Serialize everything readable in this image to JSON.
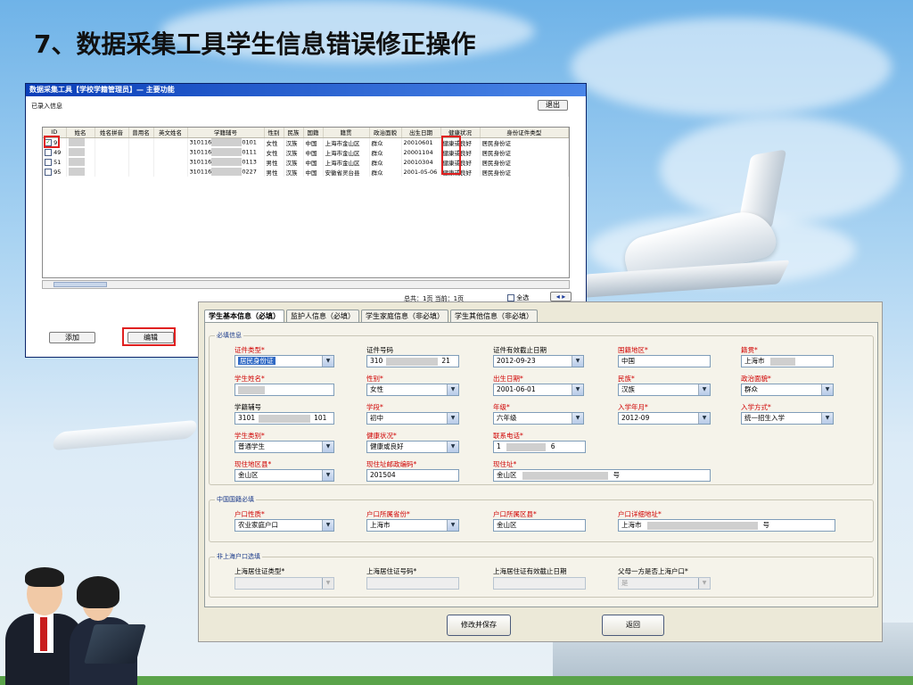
{
  "slide": {
    "title": "7、数据采集工具学生信息错误修正操作"
  },
  "list_window": {
    "title": "数据采集工具【学校学籍管理员】— 主要功能",
    "section_label": "已录入信息",
    "exit_button": "退出",
    "columns": [
      "ID",
      "姓名",
      "姓名拼音",
      "曾用名",
      "英文姓名",
      "学籍辅号",
      "性别",
      "民族",
      "国籍",
      "籍贯",
      "政治面貌",
      "出生日期",
      "健康状况",
      "身份证件类型"
    ],
    "rows": [
      {
        "checked": true,
        "id": "9",
        "name": "",
        "stu_no_start": "310116",
        "stu_no_end": "0101",
        "gender": "女性",
        "ethnic": "汉族",
        "nation": "中国",
        "native": "上海市金山区",
        "political": "群众",
        "birth": "20010601",
        "health": "健康或良好",
        "idtype": "居民身份证"
      },
      {
        "checked": false,
        "id": "49",
        "name": "",
        "stu_no_start": "310116",
        "stu_no_end": "0111",
        "gender": "女性",
        "ethnic": "汉族",
        "nation": "中国",
        "native": "上海市金山区",
        "political": "群众",
        "birth": "20001104",
        "health": "健康或良好",
        "idtype": "居民身份证"
      },
      {
        "checked": false,
        "id": "51",
        "name": "",
        "stu_no_start": "310116",
        "stu_no_end": "0113",
        "gender": "男性",
        "ethnic": "汉族",
        "nation": "中国",
        "native": "上海市金山区",
        "political": "群众",
        "birth": "20010304",
        "health": "健康或良好",
        "idtype": "居民身份证"
      },
      {
        "checked": false,
        "id": "95",
        "name": "",
        "stu_no_start": "310116",
        "stu_no_end": "0227",
        "gender": "男性",
        "ethnic": "汉族",
        "nation": "中国",
        "native": "安徽省灵台县",
        "political": "群众",
        "birth": "2001-05-06",
        "health": "健康或良好",
        "idtype": "居民身份证"
      }
    ],
    "total_text": "总共：1页  当前：1页",
    "select_all": "全选",
    "add_button": "添加",
    "edit_button": "编辑"
  },
  "edit_window": {
    "tabs": [
      "学生基本信息（必填）",
      "监护人信息（必填）",
      "学生家庭信息（非必填）",
      "学生其他信息（非必填）"
    ],
    "group_required": "必填信息",
    "fields": {
      "id_type_label": "证件类型*",
      "id_type_value": "居民身份证",
      "id_no_label": "证件号码",
      "id_no_start": "310",
      "id_no_end": "21",
      "id_expiry_label": "证件有效截止日期",
      "id_expiry_value": "2012-09-23",
      "nationality_label": "国籍地区*",
      "nationality_value": "中国",
      "native_label": "籍贯*",
      "native_value": "上海市",
      "name_label": "学生姓名*",
      "name_value": "",
      "gender_label": "性别*",
      "gender_value": "女性",
      "birth_label": "出生日期*",
      "birth_value": "2001-06-01",
      "ethnic_label": "民族*",
      "ethnic_value": "汉族",
      "political_label": "政治面貌*",
      "political_value": "群众",
      "stu_no_label": "学籍辅号",
      "stu_no_start": "3101",
      "stu_no_end": "101",
      "stage_label": "学段*",
      "stage_value": "初中",
      "grade_label": "年级*",
      "grade_value": "六年级",
      "enroll_label": "入学年月*",
      "enroll_value": "2012-09",
      "enroll_way_label": "入学方式*",
      "enroll_way_value": "统一招生入学",
      "category_label": "学生类别*",
      "category_value": "普通学生",
      "health_label": "健康状况*",
      "health_value": "健康或良好",
      "phone_label": "联系电话*",
      "phone_start": "1",
      "phone_end": "6",
      "district_label": "现住地区县*",
      "district_value": "金山区",
      "postcode_label": "现住址邮政编码*",
      "postcode_value": "201504",
      "address_label": "现住址*",
      "address_start": "金山区",
      "address_end": "号"
    },
    "group_domestic": "中国国籍必填",
    "domestic": {
      "hukou_type_label": "户口性质*",
      "hukou_type_value": "农业家庭户口",
      "hukou_prov_label": "户口所属省份*",
      "hukou_prov_value": "上海市",
      "hukou_district_label": "户口所属区县*",
      "hukou_district_value": "金山区",
      "hukou_addr_label": "户口详细地址*",
      "hukou_addr_start": "上海市",
      "hukou_addr_end": "号"
    },
    "group_nonlocal": "非上海户口选填",
    "nonlocal": {
      "permit_type_label": "上海居住证类型*",
      "permit_no_label": "上海居住证号码*",
      "permit_expiry_label": "上海居住证有效截止日期",
      "parent_local_label": "父母一方是否上海户口*",
      "parent_local_value": "是"
    },
    "save_button": "修改并保存",
    "back_button": "返回"
  }
}
